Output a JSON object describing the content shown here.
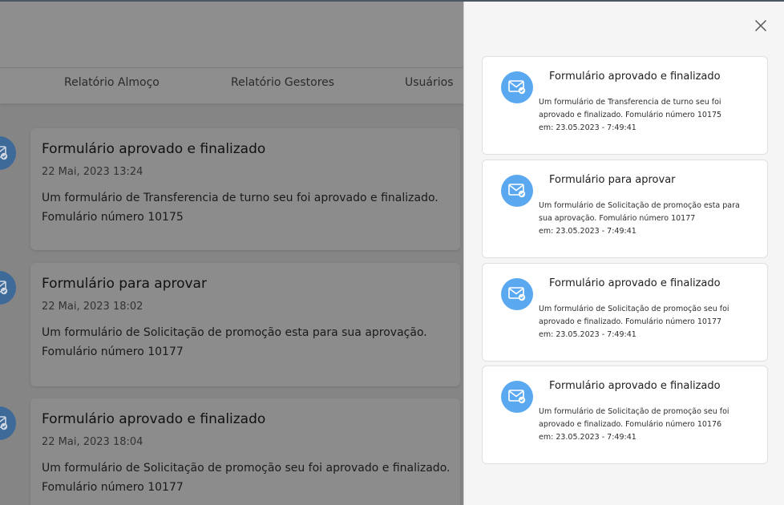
{
  "nav": {
    "items": [
      "Relatório Almoço",
      "Relatório Gestores",
      "Usuários"
    ]
  },
  "timeline": [
    {
      "title": "Formulário aprovado e finalizado",
      "date": "22 Mai, 2023 13:24",
      "message": "Um formulário de Transferencia de turno seu foi aprovado e finalizado. Fomulário número 10175"
    },
    {
      "title": "Formulário para aprovar",
      "date": "22 Mai, 2023 18:02",
      "message": "Um formulário de Solicitação de promoção esta para sua aprovação. Fomulário número 10177"
    },
    {
      "title": "Formulário aprovado e finalizado",
      "date": "22 Mai, 2023 18:04",
      "message": "Um formulário de Solicitação de promoção seu foi aprovado e finalizado. Fomulário número 10177"
    }
  ],
  "panel": {
    "close_icon": "close-icon",
    "notifications": [
      {
        "title": "Formulário aprovado e finalizado",
        "line1": "Um formulário de Transferencia de turno seu foi",
        "line2": "aprovado e finalizado. Fomulário número 10175",
        "line3": "em: 23.05.2023 - 7:49:41"
      },
      {
        "title": "Formulário para aprovar",
        "line1": "Um formulário de Solicitação de promoção esta para",
        "line2": "sua aprovação. Fomulário número 10177",
        "line3": "em: 23.05.2023 - 7:49:41"
      },
      {
        "title": "Formulário aprovado e finalizado",
        "line1": "Um formulário de Solicitação de promoção seu foi",
        "line2": "aprovado e finalizado. Fomulário número 10177",
        "line3": "em: 23.05.2023 - 7:49:41"
      },
      {
        "title": "Formulário aprovado e finalizado",
        "line1": "Um formulário de Solicitação de promoção seu foi",
        "line2": "aprovado e finalizado. Fomulário número 10176",
        "line3": "em: 23.05.2023 - 7:49:41"
      }
    ]
  },
  "colors": {
    "icon_bg": "#5aa9f0",
    "overlay_bg": "#858585",
    "panel_bg": "#f5f5f5"
  }
}
